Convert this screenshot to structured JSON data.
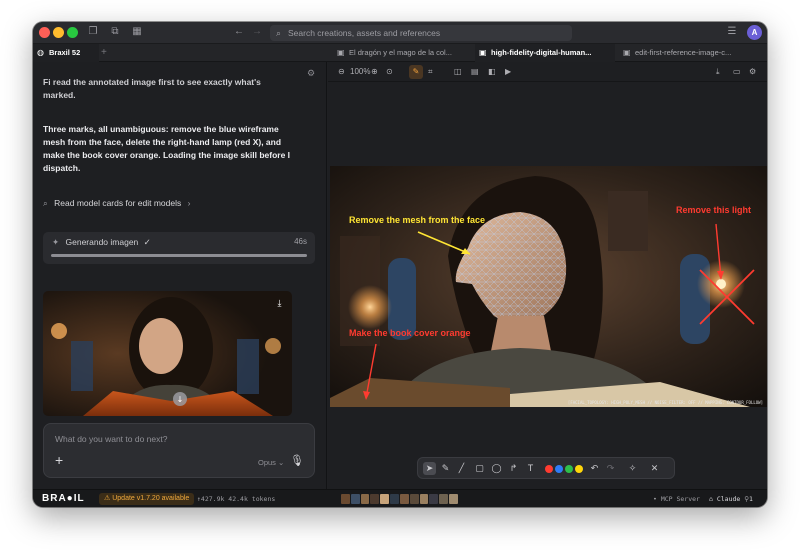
{
  "titlebar": {
    "search_placeholder": "Search creations, assets and references",
    "avatar_initial": "A"
  },
  "tabs": [
    {
      "label": "Braxil 52",
      "active": true
    },
    {
      "label": "El dragón y el mago de la col...",
      "active": false
    },
    {
      "label": "high-fidelity-digital-human...",
      "active": true
    },
    {
      "label": "edit-first-reference-image-c...",
      "active": false
    }
  ],
  "chat": {
    "msg_top": "First read the annotated image first to see exactly what's marked.",
    "msg_top_cut": "Fi read the annotated image first to see exactly what's",
    "msg_top_line2": "marked.",
    "msg_main_l1": "Three marks, all unambiguous: remove the blue wireframe",
    "msg_main_l2": "mesh from the face, delete the right-hand lamp (red X), and",
    "msg_main_l3": "make the book cover orange. Loading the image skill before I",
    "msg_main_l4": "dispatch.",
    "link": "Read model cards for edit models",
    "tool_label": "Generando imagen",
    "tool_time": "46s",
    "progress": 1.0
  },
  "composer": {
    "placeholder": "What do you want to do next?",
    "model": "Opus"
  },
  "image_toolbar": {
    "zoom": "100%"
  },
  "annotations": {
    "mesh": "Remove the mesh from the face",
    "light": "Remove this light",
    "book": "Make the book cover orange",
    "watermark": "[FACIAL_TOPOLOGY: HIGH_POLY_MESH // NOISE_FILTER: OFF // MAPPING: CONTOUR_FOLLOW]"
  },
  "colors": {
    "accent": "#f2a13b",
    "annot_yellow": "#ffe534",
    "annot_red": "#ff3b30",
    "swatches": [
      "#ff3b30",
      "#2f7cf6",
      "#2fbf4a",
      "#ffd60a"
    ]
  },
  "statusbar": {
    "logo": "BRA●IL",
    "update": "Update v1.7.20 available",
    "tokens": "↑427.9k 42.4k tokens",
    "mcp": "• MCP Server",
    "claude": "Claude",
    "count": "1"
  }
}
